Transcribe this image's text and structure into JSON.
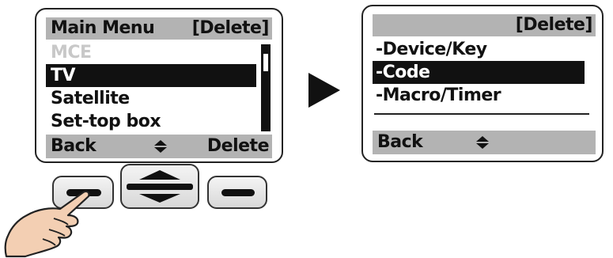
{
  "left_screen": {
    "header_title": "Main Menu",
    "header_action": "[Delete]",
    "items": [
      {
        "label": "MCE",
        "state": "disabled"
      },
      {
        "label": "TV",
        "state": "selected"
      },
      {
        "label": "Satellite",
        "state": "normal"
      },
      {
        "label": "Set-top box",
        "state": "normal"
      }
    ],
    "footer_left": "Back",
    "footer_mid_icon": "up-down-arrows-icon",
    "footer_right": "Delete"
  },
  "right_screen": {
    "header_action": "[Delete]",
    "items": [
      {
        "label": "-Device/Key",
        "state": "normal"
      },
      {
        "label": "-Code",
        "state": "selected"
      },
      {
        "label": "-Macro/Timer",
        "state": "normal"
      }
    ],
    "footer_left": "Back",
    "footer_mid_icon": "up-down-arrows-icon"
  },
  "transition_icon": "right-arrow-icon",
  "hardware_buttons": [
    {
      "name": "left-soft-key",
      "icon": "dash-icon"
    },
    {
      "name": "navigation-rocker",
      "icon": "up-down-arrows-icon"
    },
    {
      "name": "right-soft-key",
      "icon": "dash-icon"
    }
  ],
  "pointer_icon": "pointing-hand-icon",
  "colors": {
    "selection_bg": "#111111",
    "bar_bg": "#b3b3b3",
    "disabled_text": "#c8c8c8"
  }
}
